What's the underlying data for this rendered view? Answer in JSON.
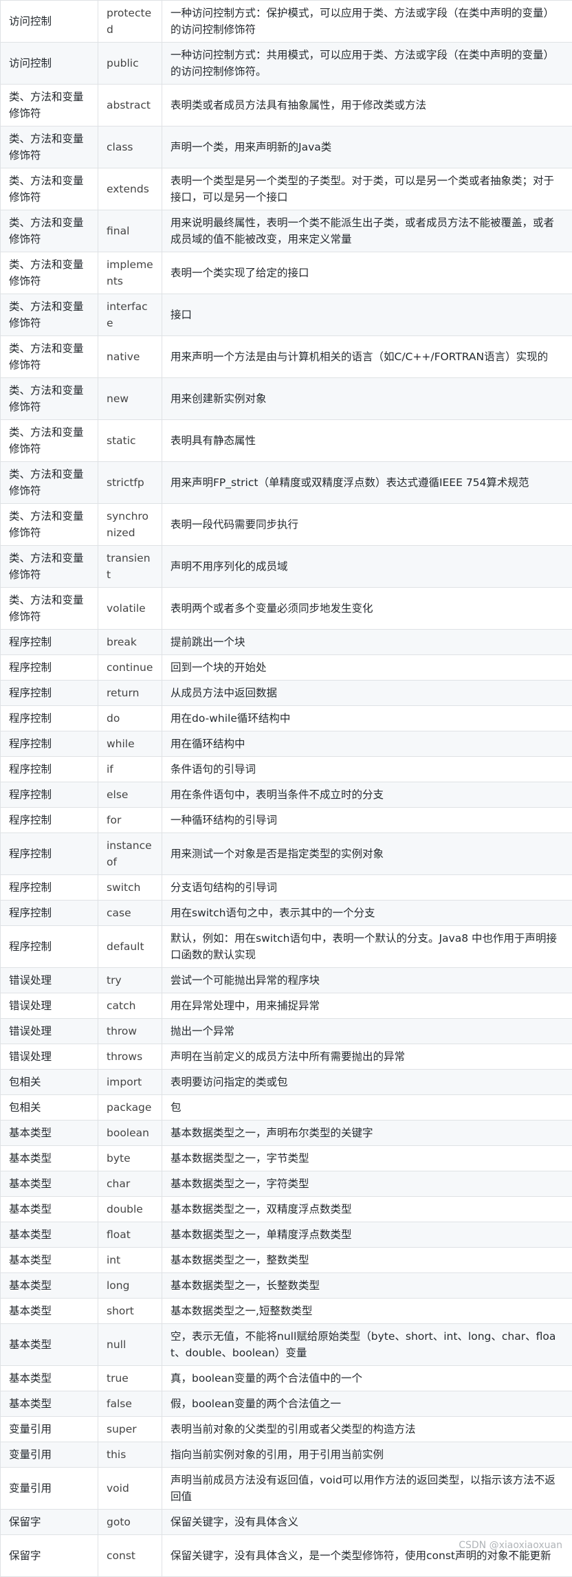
{
  "rows": [
    {
      "category": "访问控制",
      "keyword": "protected",
      "description": "一种访问控制方式：保护模式，可以应用于类、方法或字段（在类中声明的变量）的访问控制修饰符"
    },
    {
      "category": "访问控制",
      "keyword": "public",
      "description": "一种访问控制方式：共用模式，可以应用于类、方法或字段（在类中声明的变量）的访问控制修饰符。"
    },
    {
      "category": "类、方法和变量修饰符",
      "keyword": "abstract",
      "description": "表明类或者成员方法具有抽象属性，用于修改类或方法"
    },
    {
      "category": "类、方法和变量修饰符",
      "keyword": "class",
      "description": "声明一个类，用来声明新的Java类"
    },
    {
      "category": "类、方法和变量修饰符",
      "keyword": "extends",
      "description": "表明一个类型是另一个类型的子类型。对于类，可以是另一个类或者抽象类；对于接口，可以是另一个接口"
    },
    {
      "category": "类、方法和变量修饰符",
      "keyword": "final",
      "description": "用来说明最终属性，表明一个类不能派生出子类，或者成员方法不能被覆盖，或者成员域的值不能被改变，用来定义常量"
    },
    {
      "category": "类、方法和变量修饰符",
      "keyword": "implements",
      "description": "表明一个类实现了给定的接口"
    },
    {
      "category": "类、方法和变量修饰符",
      "keyword": "interface",
      "description": "接口"
    },
    {
      "category": "类、方法和变量修饰符",
      "keyword": "native",
      "description": "用来声明一个方法是由与计算机相关的语言（如C/C++/FORTRAN语言）实现的"
    },
    {
      "category": "类、方法和变量修饰符",
      "keyword": "new",
      "description": "用来创建新实例对象"
    },
    {
      "category": "类、方法和变量修饰符",
      "keyword": "static",
      "description": "表明具有静态属性"
    },
    {
      "category": "类、方法和变量修饰符",
      "keyword": "strictfp",
      "description": "用来声明FP_strict（单精度或双精度浮点数）表达式遵循IEEE 754算术规范"
    },
    {
      "category": "类、方法和变量修饰符",
      "keyword": "synchronized",
      "description": "表明一段代码需要同步执行"
    },
    {
      "category": "类、方法和变量修饰符",
      "keyword": "transient",
      "description": "声明不用序列化的成员域"
    },
    {
      "category": "类、方法和变量修饰符",
      "keyword": "volatile",
      "description": "表明两个或者多个变量必须同步地发生变化"
    },
    {
      "category": "程序控制",
      "keyword": "break",
      "description": "提前跳出一个块"
    },
    {
      "category": "程序控制",
      "keyword": "continue",
      "description": "回到一个块的开始处"
    },
    {
      "category": "程序控制",
      "keyword": "return",
      "description": "从成员方法中返回数据"
    },
    {
      "category": "程序控制",
      "keyword": "do",
      "description": "用在do-while循环结构中"
    },
    {
      "category": "程序控制",
      "keyword": "while",
      "description": "用在循环结构中"
    },
    {
      "category": "程序控制",
      "keyword": "if",
      "description": "条件语句的引导词"
    },
    {
      "category": "程序控制",
      "keyword": "else",
      "description": "用在条件语句中，表明当条件不成立时的分支"
    },
    {
      "category": "程序控制",
      "keyword": "for",
      "description": "一种循环结构的引导词"
    },
    {
      "category": "程序控制",
      "keyword": "instanceof",
      "description": "用来测试一个对象是否是指定类型的实例对象"
    },
    {
      "category": "程序控制",
      "keyword": "switch",
      "description": "分支语句结构的引导词"
    },
    {
      "category": "程序控制",
      "keyword": "case",
      "description": "用在switch语句之中，表示其中的一个分支"
    },
    {
      "category": "程序控制",
      "keyword": "default",
      "description": "默认，例如：用在switch语句中，表明一个默认的分支。Java8 中也作用于声明接口函数的默认实现"
    },
    {
      "category": "错误处理",
      "keyword": "try",
      "description": "尝试一个可能抛出异常的程序块"
    },
    {
      "category": "错误处理",
      "keyword": "catch",
      "description": "用在异常处理中，用来捕捉异常"
    },
    {
      "category": "错误处理",
      "keyword": "throw",
      "description": "抛出一个异常"
    },
    {
      "category": "错误处理",
      "keyword": "throws",
      "description": "声明在当前定义的成员方法中所有需要抛出的异常"
    },
    {
      "category": "包相关",
      "keyword": "import",
      "description": "表明要访问指定的类或包"
    },
    {
      "category": "包相关",
      "keyword": "package",
      "description": "包"
    },
    {
      "category": "基本类型",
      "keyword": "boolean",
      "description": "基本数据类型之一，声明布尔类型的关键字"
    },
    {
      "category": "基本类型",
      "keyword": "byte",
      "description": "基本数据类型之一，字节类型"
    },
    {
      "category": "基本类型",
      "keyword": "char",
      "description": "基本数据类型之一，字符类型"
    },
    {
      "category": "基本类型",
      "keyword": "double",
      "description": "基本数据类型之一，双精度浮点数类型"
    },
    {
      "category": "基本类型",
      "keyword": "float",
      "description": "基本数据类型之一，单精度浮点数类型"
    },
    {
      "category": "基本类型",
      "keyword": "int",
      "description": "基本数据类型之一，整数类型"
    },
    {
      "category": "基本类型",
      "keyword": "long",
      "description": "基本数据类型之一，长整数类型"
    },
    {
      "category": "基本类型",
      "keyword": "short",
      "description": "基本数据类型之一,短整数类型"
    },
    {
      "category": "基本类型",
      "keyword": "null",
      "description": "空，表示无值，不能将null赋给原始类型（byte、short、int、long、char、float、double、boolean）变量"
    },
    {
      "category": "基本类型",
      "keyword": "true",
      "description": "真，boolean变量的两个合法值中的一个"
    },
    {
      "category": "基本类型",
      "keyword": "false",
      "description": "假，boolean变量的两个合法值之一"
    },
    {
      "category": "变量引用",
      "keyword": "super",
      "description": "表明当前对象的父类型的引用或者父类型的构造方法"
    },
    {
      "category": "变量引用",
      "keyword": "this",
      "description": "指向当前实例对象的引用，用于引用当前实例"
    },
    {
      "category": "变量引用",
      "keyword": "void",
      "description": "声明当前成员方法没有返回值，void可以用作方法的返回类型，以指示该方法不返回值"
    },
    {
      "category": "保留字",
      "keyword": "goto",
      "description": "保留关键字，没有具体含义"
    },
    {
      "category": "保留字",
      "keyword": "const",
      "description": "保留关键字，没有具体含义，是一个类型修饰符，使用const声明的对象不能更新"
    }
  ],
  "watermark": "CSDN @xiaoxiaoxuan"
}
